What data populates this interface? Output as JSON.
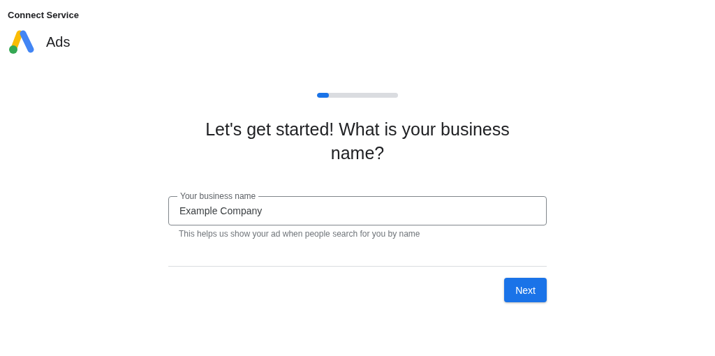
{
  "header": {
    "title": "Connect Service",
    "product": "Ads"
  },
  "progress": {
    "level": 0.15
  },
  "heading": "Let's get started! What is your business name?",
  "field": {
    "label": "Your business name",
    "value": "Example Company",
    "helper": "This helps us show your ad when people search for you by name"
  },
  "buttons": [
    {
      "label": "Next"
    }
  ]
}
